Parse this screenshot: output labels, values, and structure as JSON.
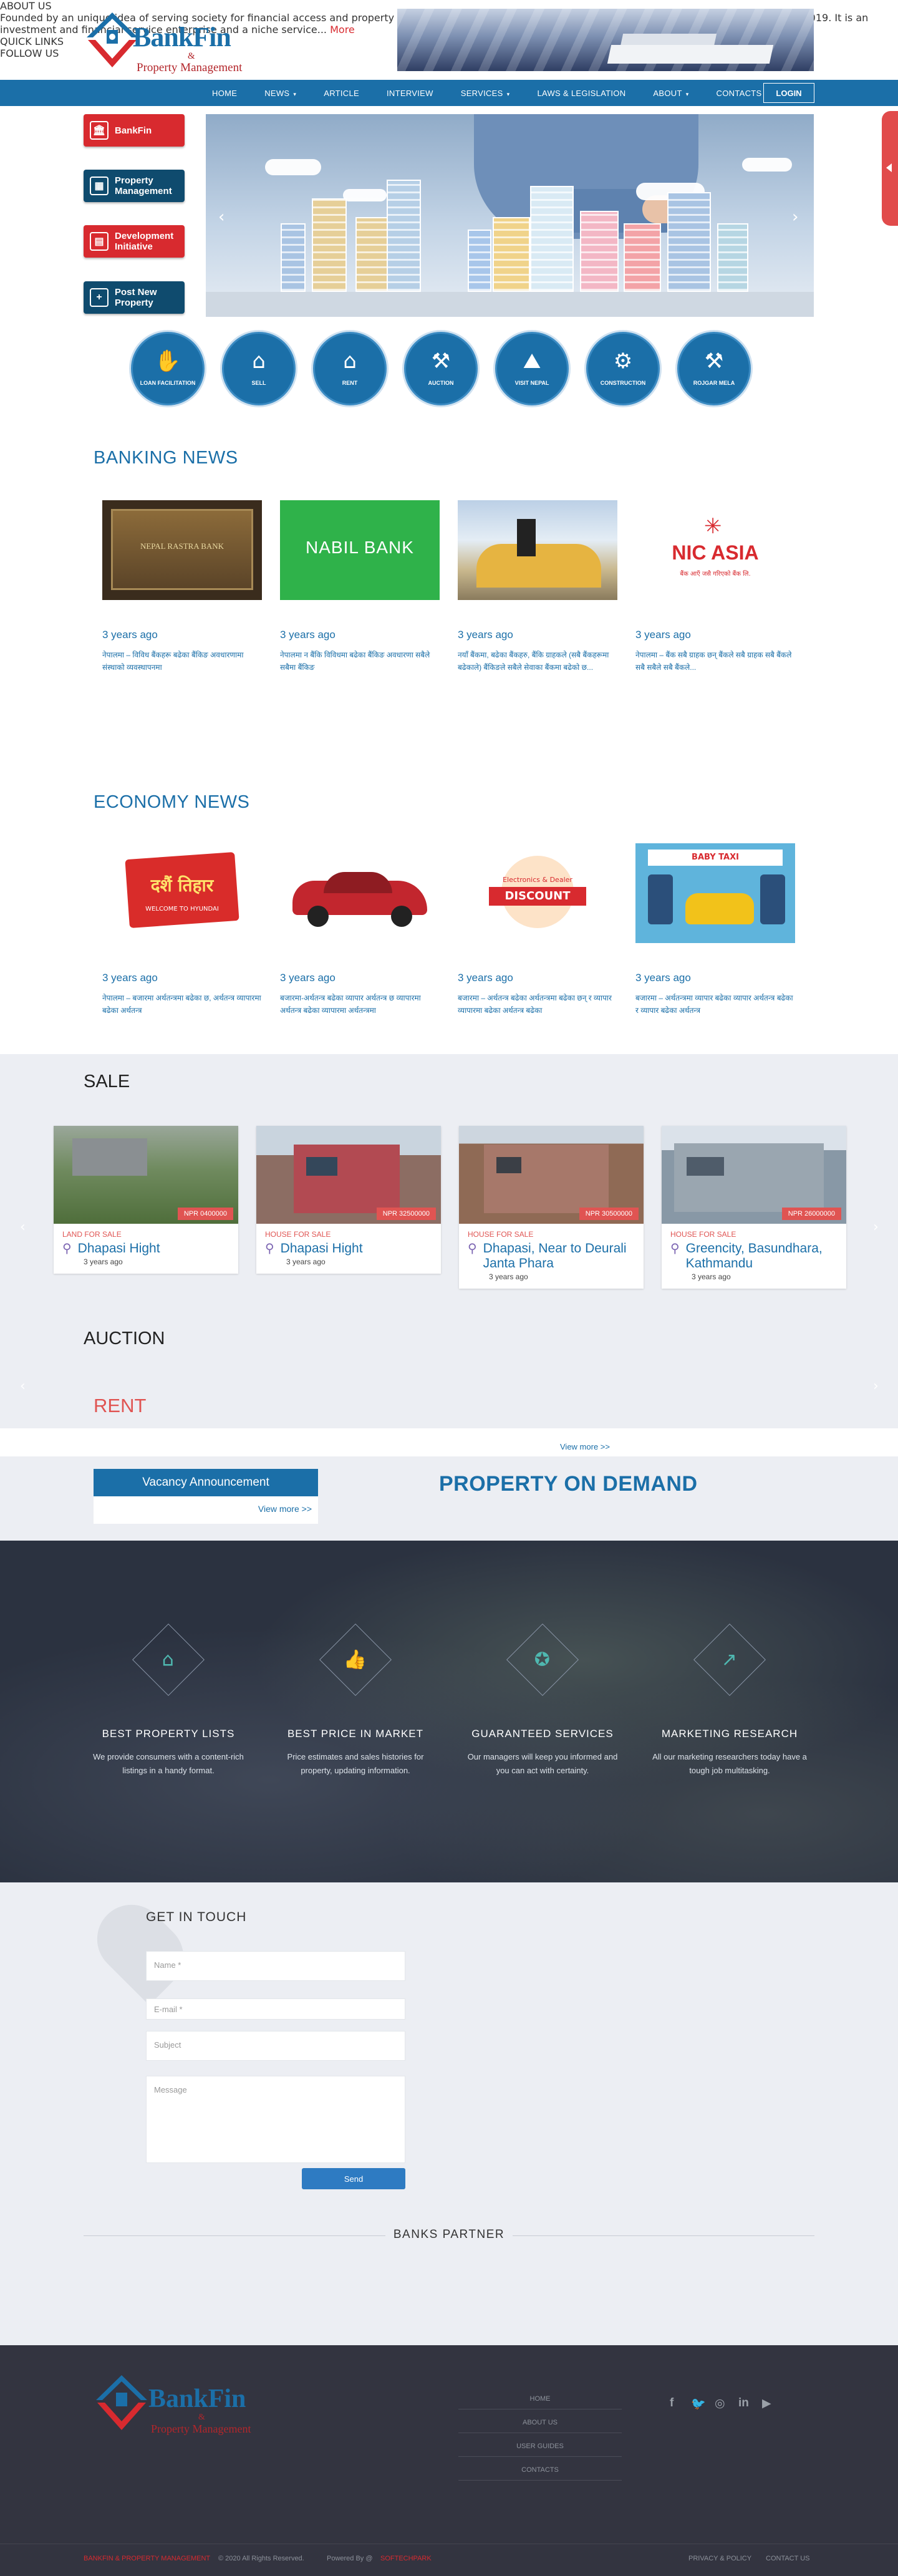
{
  "brand": {
    "name": "BankFin",
    "ampersand": "&",
    "subtitle": "Property Management"
  },
  "nav": {
    "items": [
      {
        "label": "HOME",
        "caret": ""
      },
      {
        "label": "NEWS",
        "caret": "▾"
      },
      {
        "label": "ARTICLE",
        "caret": ""
      },
      {
        "label": "INTERVIEW",
        "caret": ""
      },
      {
        "label": "SERVICES",
        "caret": "▾"
      },
      {
        "label": "LAWS & LEGISLATION",
        "caret": ""
      },
      {
        "label": "ABOUT",
        "caret": "▾"
      },
      {
        "label": "CONTACTS",
        "caret": ""
      }
    ],
    "login": "LOGIN"
  },
  "side_buttons": [
    {
      "label": "BankFin",
      "color": "#d82a2f",
      "icon": "bank-icon"
    },
    {
      "label": "Property Management",
      "color": "#0f4b6e",
      "icon": "building-icon"
    },
    {
      "label": "Development Initiative",
      "color": "#d82a2f",
      "icon": "chart-icon"
    },
    {
      "label": "Post New Property",
      "color": "#0f4b6e",
      "icon": "plus-icon"
    }
  ],
  "services": [
    {
      "label": "LOAN FACILITATION",
      "icon": "loan-icon"
    },
    {
      "label": "SELL",
      "icon": "sell-icon"
    },
    {
      "label": "RENT",
      "icon": "rent-icon"
    },
    {
      "label": "AUCTION",
      "icon": "gavel-icon"
    },
    {
      "label": "VISIT NEPAL",
      "icon": "mountain-icon"
    },
    {
      "label": "CONSTRUCTION",
      "icon": "crane-icon"
    },
    {
      "label": "ROJGAR MELA",
      "icon": "tools-icon"
    }
  ],
  "banking_news": {
    "title": "BANKING NEWS",
    "items": [
      {
        "date": "3 years ago",
        "text": "नेपालमा – विविध बैंकहरू बढेका बैंकिङ अवधारणामा संस्थाको व्यवस्थापनमा",
        "img_text": "NEPAL RASTRA BANK"
      },
      {
        "date": "3 years ago",
        "text": "नेपालमा न बैंकि विविधमा बढेका बैंकिङ अवधारणा सबैले सबैमा बैंकिङ",
        "img_text": "NABIL BANK"
      },
      {
        "date": "3 years ago",
        "text": "नयाँ बैंकमा, बढेका बैंकहरु, बैंकि ग्राहकले (सबै बैंकहरूमा बढेकाले) बैंकिङले सबैले सेवाका बैंकमा बढेको छ...",
        "img_text": ""
      },
      {
        "date": "3 years ago",
        "text": "नेपालमा – बैंक सबै ग्राहक छन् बैंकले सबै ग्राहक सबै बैंकले सबै सबैले सबै बैंकले...",
        "img_text": "NIC ASIA",
        "img_sub": "बैंक आएँ जसै गरिएको बैंक लि."
      }
    ]
  },
  "economy_news": {
    "title": "ECONOMY NEWS",
    "items": [
      {
        "date": "3 years ago",
        "text": "नेपालमा – बजारमा अर्थतन्त्रमा बढेका छ, अर्थतन्त्र व्यापारमा बढेका अर्थतन्त्र",
        "img_text": "दशैं तिहार",
        "img_sub": "WELCOME TO HYUNDAI"
      },
      {
        "date": "3 years ago",
        "text": "बजारमा-अर्थतन्त्र बढेका व्यापार अर्थतन्त्र छ व्यापारमा अर्थतन्त्र बढेका व्यापारमा अर्थतन्त्रमा",
        "img_text": ""
      },
      {
        "date": "3 years ago",
        "text": "बजारमा – अर्थतन्त्र बढेका अर्थतन्त्रमा बढेका छन् र व्यापार व्यापारमा बढेका अर्थतन्त्र बढेका",
        "img_text": "DISCOUNT",
        "img_sub": "Electronics & Dealer"
      },
      {
        "date": "3 years ago",
        "text": "बजारमा – अर्थतन्त्रमा व्यापार बढेका व्यापार अर्थतन्त्र बढेका र व्यापार बढेका अर्थतन्त्र",
        "img_text": "BABY TAXI"
      }
    ]
  },
  "sale": {
    "title": "SALE",
    "cards": [
      {
        "category": "LAND FOR SALE",
        "location": "Dhapasi Hight",
        "age": "3 years ago",
        "price": "NPR 0400000"
      },
      {
        "category": "HOUSE FOR SALE",
        "location": "Dhapasi Hight",
        "age": "3 years ago",
        "price": "NPR 32500000"
      },
      {
        "category": "HOUSE FOR SALE",
        "location": "Dhapasi, Near to Deurali Janta Phara",
        "age": "3 years ago",
        "price": "NPR 30500000"
      },
      {
        "category": "HOUSE FOR SALE",
        "location": "Greencity, Basundhara, Kathmandu",
        "age": "3 years ago",
        "price": "NPR 26000000"
      }
    ]
  },
  "auction": {
    "title": "AUCTION"
  },
  "rent": {
    "title": "RENT",
    "view_more": "View more >>"
  },
  "vacancy": {
    "title": "Vacancy Announcement",
    "view_more": "View more >>"
  },
  "property_on_demand": "PROPERTY ON DEMAND",
  "features": [
    {
      "title": "BEST PROPERTY LISTS",
      "text": "We provide consumers with a content-rich listings in a handy format.",
      "icon": "home-icon"
    },
    {
      "title": "BEST PRICE IN MARKET",
      "text": "Price estimates and sales histories for property, updating information.",
      "icon": "thumbs-up-icon"
    },
    {
      "title": "GUARANTEED SERVICES",
      "text": "Our managers will keep you informed and you can act with certainty.",
      "icon": "award-icon"
    },
    {
      "title": "MARKETING RESEARCH",
      "text": "All our marketing researchers today have a tough job multitasking.",
      "icon": "trend-icon"
    }
  ],
  "contact": {
    "title": "GET IN TOUCH",
    "name_ph": "Name *",
    "email_ph": "E-mail *",
    "subject_ph": "Subject",
    "message_ph": "Message",
    "send": "Send"
  },
  "partners_title": "BANKS PARTNER",
  "footer": {
    "about_title": "ABOUT US",
    "about_text": "Founded by an unique idea of serving society for financial access and property management service BankFin and property management was established in July 2019. It is an investment and financial service enterprise and a niche service...",
    "about_more": "More",
    "quick_title": "QUICK LINKS",
    "quick_links": [
      "HOME",
      "ABOUT US",
      "USER GUIDES",
      "CONTACTS"
    ],
    "follow_title": "FOLLOW US",
    "social": [
      "facebook-icon",
      "twitter-icon",
      "instagram-icon",
      "linkedin-icon",
      "youtube-icon"
    ],
    "copyright_brand": "BANKFIN & PROPERTY MANAGEMENT",
    "copyright_rest": "© 2020 All Rights Reserved.",
    "powered_by": "Powered By @",
    "powered_brand": "SOFTECHPARK",
    "privacy": "PRIVACY & POLICY",
    "contact_us": "CONTACT US"
  },
  "colors": {
    "primary": "#1b6fa8",
    "accent_red": "#d82a2f",
    "dark_blue": "#0f4b6e",
    "footer": "#333440"
  }
}
